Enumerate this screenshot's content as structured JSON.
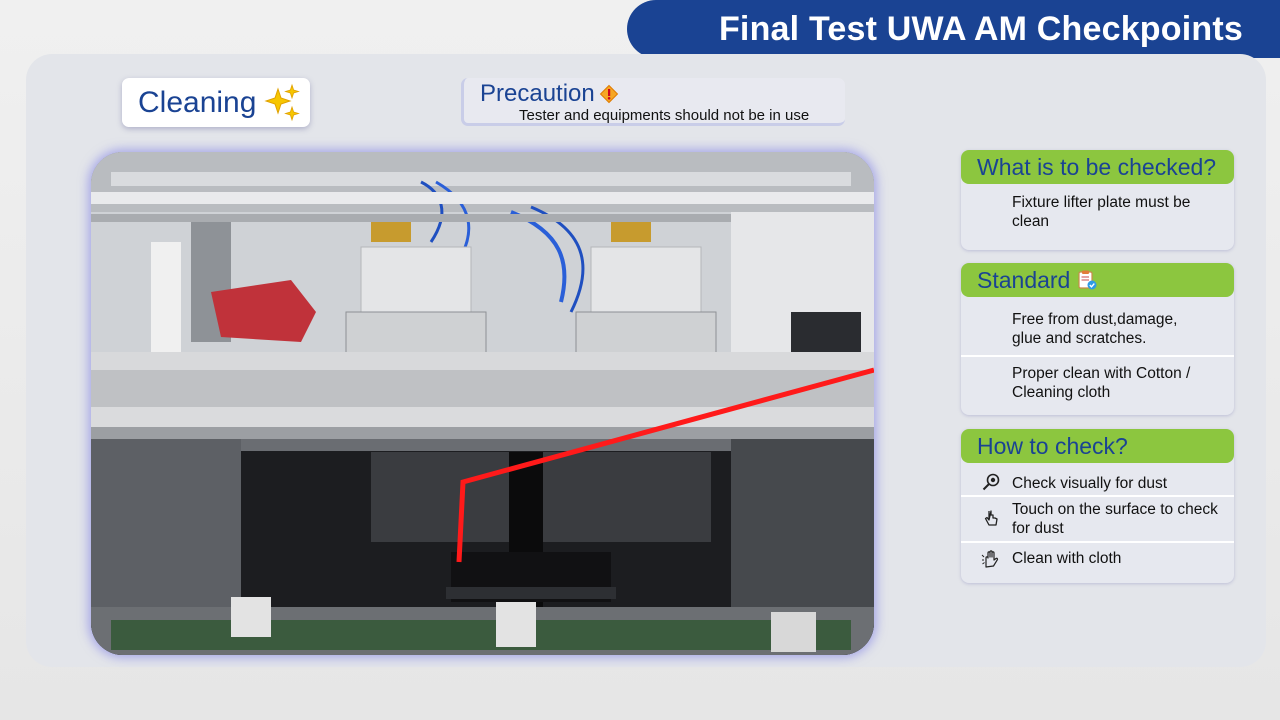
{
  "header": {
    "title": "Final Test UWA AM Checkpoints"
  },
  "topic": {
    "label": "Cleaning",
    "icon": "sparkles-icon"
  },
  "precaution": {
    "title": "Precaution",
    "icon": "warning-icon",
    "text": "Tester and equipments should not be in use"
  },
  "photo": {
    "icon": "fixture-photo",
    "highlight_color": "#ff1a1a"
  },
  "what_to_check": {
    "title": "What is to be checked?",
    "items": [
      {
        "text": "Fixture lifter plate must be clean"
      }
    ]
  },
  "standard": {
    "title": "Standard",
    "icon": "clipboard-check-icon",
    "items": [
      {
        "text": "Free from dust,damage, glue and scratches."
      },
      {
        "text": "Proper clean with Cotton / Cleaning cloth"
      }
    ]
  },
  "how_to_check": {
    "title": "How to check?",
    "items": [
      {
        "icon": "magnifier-icon",
        "text": "Check visually for dust"
      },
      {
        "icon": "touch-hand-icon",
        "text": "Touch on the surface to check for dust"
      },
      {
        "icon": "wiping-hand-icon",
        "text": "Clean with cloth"
      }
    ]
  },
  "colors": {
    "brand_blue": "#1a4393",
    "header_green": "#8cc63f",
    "panel_bg": "#e3e5ea"
  }
}
